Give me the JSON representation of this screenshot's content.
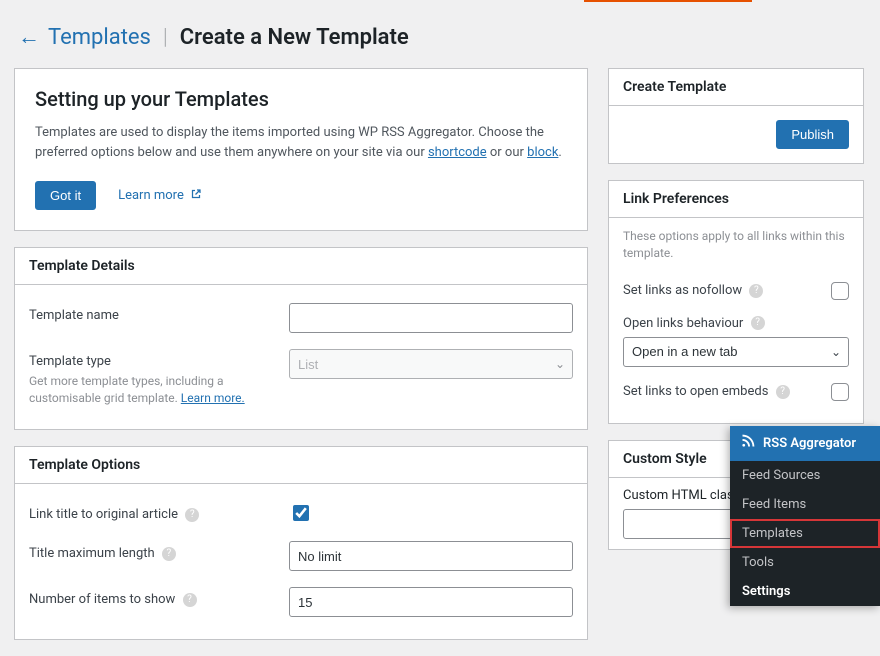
{
  "topbar": {
    "orange_left": 584,
    "orange_width": 168
  },
  "breadcrumb": {
    "back_label": "Templates",
    "current": "Create a New Template"
  },
  "intro": {
    "title": "Setting up your Templates",
    "text_pre": "Templates are used to display the items imported using WP RSS Aggregator. Choose the preferred options below and use them anywhere on your site via our ",
    "shortcode_link": "shortcode",
    "text_mid": " or our ",
    "block_link": "block",
    "text_post": ".",
    "gotit": "Got it",
    "learnmore": "Learn more"
  },
  "details": {
    "header": "Template Details",
    "name_label": "Template name",
    "name_value": "",
    "type_label": "Template type",
    "type_value": "List",
    "type_hint_pre": "Get more template types, including a customisable grid template. ",
    "type_hint_link": "Learn more."
  },
  "options": {
    "header": "Template Options",
    "link_title_label": "Link title to original article",
    "link_title_checked": true,
    "title_max_label": "Title maximum length",
    "title_max_value": "No limit",
    "num_items_label": "Number of items to show",
    "num_items_value": "15"
  },
  "side": {
    "create_header": "Create Template",
    "publish": "Publish",
    "linkpref_header": "Link Preferences",
    "linkpref_note": "These options apply to all links within this template.",
    "nofollow_label": "Set links as nofollow",
    "openlinks_label": "Open links behaviour",
    "openlinks_value": "Open in a new tab",
    "embeds_label": "Set links to open embeds",
    "customstyle_header": "Custom Style",
    "customstyle_label": "Custom HTML class",
    "customstyle_value": ""
  },
  "admin_menu": {
    "head": "RSS Aggregator",
    "items": [
      {
        "label": "Feed Sources",
        "highlight": false,
        "strong": false
      },
      {
        "label": "Feed Items",
        "highlight": false,
        "strong": false
      },
      {
        "label": "Templates",
        "highlight": true,
        "strong": false
      },
      {
        "label": "Tools",
        "highlight": false,
        "strong": false
      },
      {
        "label": "Settings",
        "highlight": false,
        "strong": true
      }
    ]
  }
}
